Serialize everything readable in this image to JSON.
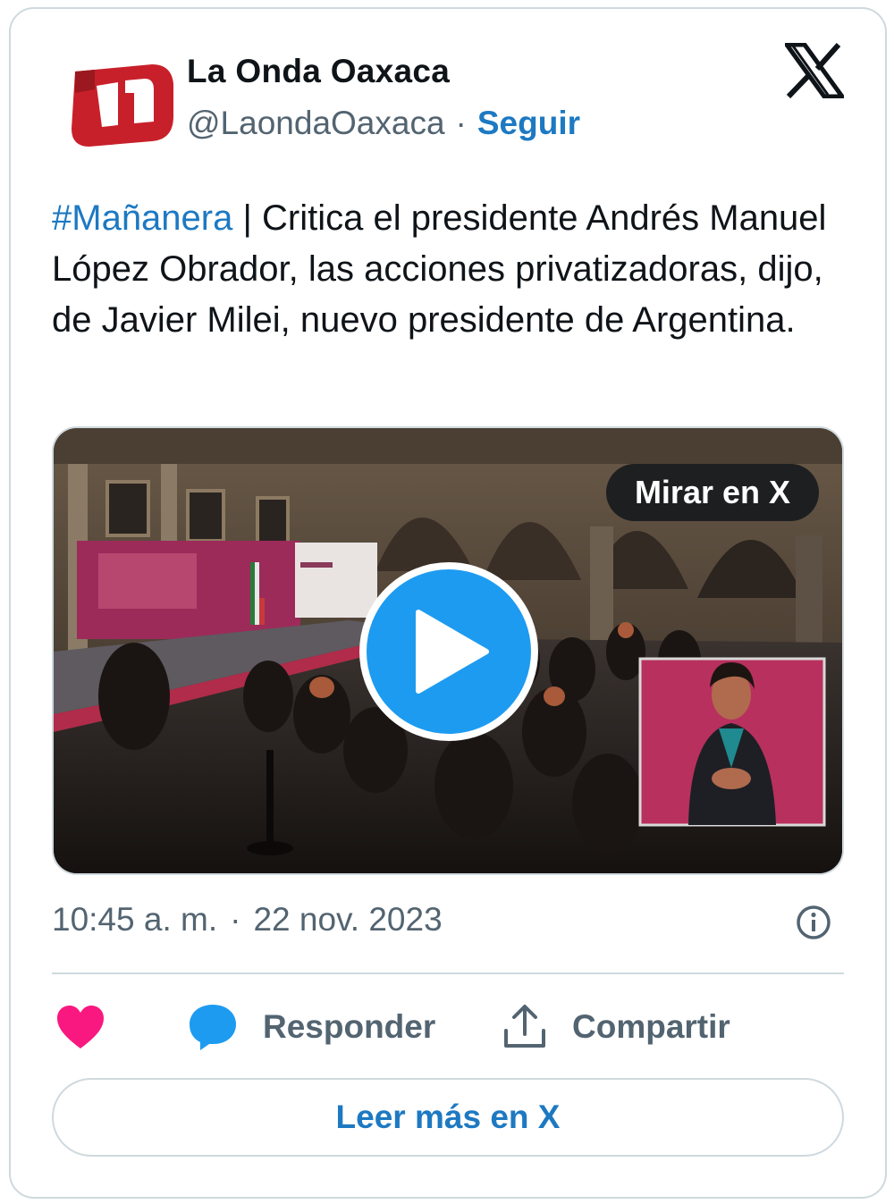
{
  "account": {
    "display_name": "La Onda Oaxaca",
    "handle": "@LaondaOaxaca",
    "separator": "·",
    "follow_label": "Seguir",
    "logo_icon": "x-logo-icon",
    "avatar_color": "#c8202a"
  },
  "tweet": {
    "hashtag": "#Mañanera",
    "body": " | Critica el presidente Andrés Manuel López Obrador, las acciones privatizadoras, dijo, de Javier Milei, nuevo presidente de Argentina."
  },
  "media": {
    "watch_label": "Mirar en X",
    "play_icon": "play-icon"
  },
  "meta": {
    "time": "10:45 a. m.",
    "separator": "·",
    "date": "22 nov. 2023",
    "info_icon": "info-icon"
  },
  "actions": {
    "like_icon": "heart-icon",
    "reply_icon": "speech-bubble-icon",
    "reply_label": "Responder",
    "share_icon": "share-upload-icon",
    "share_label": "Compartir"
  },
  "read_more_label": "Leer más en X",
  "colors": {
    "link": "#1d79c2",
    "heart": "#f91880",
    "play": "#1d9bf0",
    "border": "#cfd9de",
    "secondary_text": "#536471"
  }
}
